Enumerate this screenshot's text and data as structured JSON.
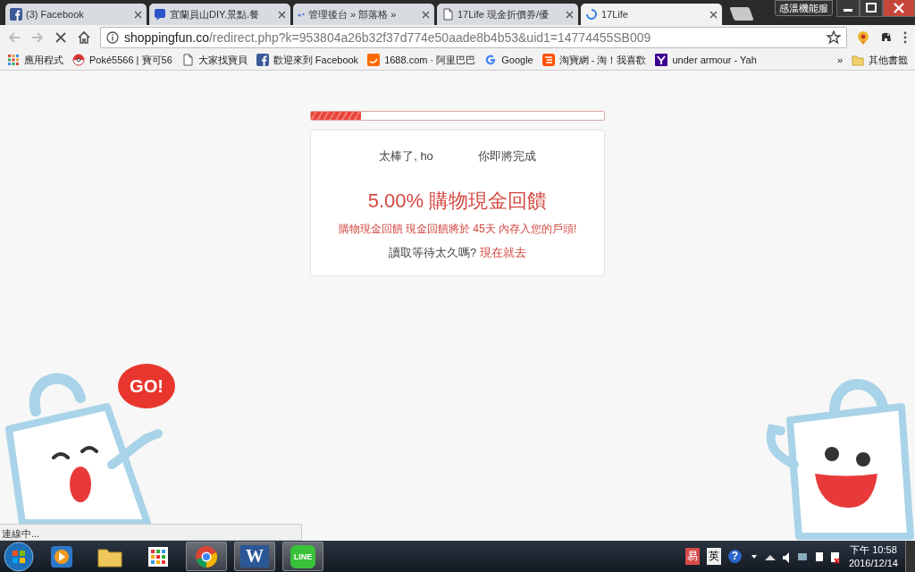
{
  "browser": {
    "tabs": [
      {
        "title": "(3) Facebook",
        "kind": "facebook",
        "selected": false
      },
      {
        "title": "宜蘭員山DIY.景點.餐",
        "kind": "chat",
        "selected": false
      },
      {
        "title": "管理後台 » 部落格 »",
        "kind": "dots",
        "selected": false
      },
      {
        "title": "17Life 現金折價券/優",
        "kind": "page",
        "selected": false
      },
      {
        "title": "17Life",
        "kind": "spinner",
        "selected": true
      }
    ],
    "window_button": "感溫機能服",
    "address": {
      "host": "shoppingfun.co",
      "path": "/redirect.php?k=953804a26b32f37d774e50aade8b4b53&uid1=14774455SB009"
    },
    "bookmarks": [
      {
        "label": "應用程式",
        "kind": "apps"
      },
      {
        "label": "Poké5566 | 寶可56",
        "kind": "ball"
      },
      {
        "label": "大家找寶貝",
        "kind": "page"
      },
      {
        "label": "歡迎來到 Facebook",
        "kind": "facebook"
      },
      {
        "label": "1688.com · 阿里巴巴",
        "kind": "smile"
      },
      {
        "label": "Google",
        "kind": "google"
      },
      {
        "label": "淘寶網 - 淘！我喜歡",
        "kind": "taobao"
      },
      {
        "label": "under armour - Yah",
        "kind": "yletter"
      }
    ],
    "more": "»",
    "other_bookmarks": "其他書籤",
    "status": "連線中..."
  },
  "page": {
    "progress": {
      "level": 0.17
    },
    "greeting": "太棒了, ho",
    "subtitle": "你即將完成",
    "headline": "5.00% 購物現金回饋",
    "note": "購物現金回饋 現金回饋將於 45天 內存入您的戶頭!",
    "prompt": "讀取等待太久嗎?",
    "link": "現在就去",
    "bubble": "GO!"
  },
  "taskbar": {
    "apps": [
      {
        "kind": "media",
        "active": false
      },
      {
        "kind": "folder",
        "active": false
      },
      {
        "kind": "grid",
        "active": false
      },
      {
        "kind": "chrome",
        "active": true
      },
      {
        "kind": "word",
        "label": "W",
        "active": true
      },
      {
        "kind": "line",
        "label": "LINE",
        "active": true
      }
    ],
    "tray": [
      {
        "kind": "ime",
        "label": "易"
      },
      {
        "kind": "lang",
        "label": "英"
      },
      {
        "kind": "help",
        "label": "?"
      }
    ],
    "time": "下午 10:58",
    "date": "2016/12/14"
  }
}
